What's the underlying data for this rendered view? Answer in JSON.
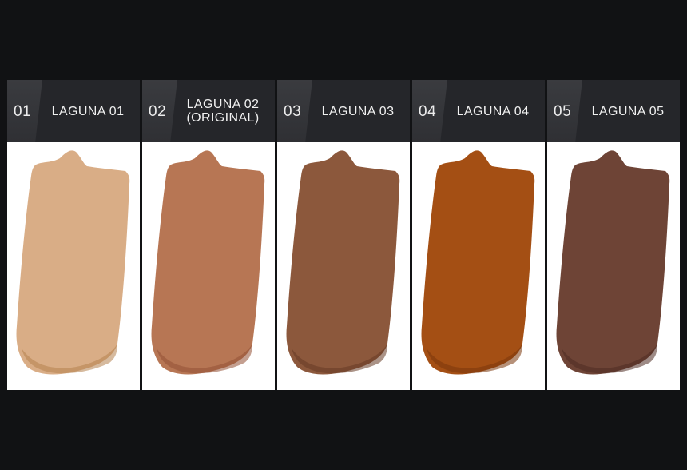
{
  "shades": [
    {
      "number": "01",
      "name": "LAGUNA 01",
      "color": "#d9ad86",
      "shadow": "#b4824f"
    },
    {
      "number": "02",
      "name": "LAGUNA 02\n(ORIGINAL)",
      "color": "#b77654",
      "shadow": "#935034"
    },
    {
      "number": "03",
      "name": "LAGUNA 03",
      "color": "#8c583c",
      "shadow": "#663b25"
    },
    {
      "number": "04",
      "name": "LAGUNA 04",
      "color": "#a44f14",
      "shadow": "#7a360b"
    },
    {
      "number": "05",
      "name": "LAGUNA 05",
      "color": "#6e4436",
      "shadow": "#4e2c22"
    }
  ]
}
